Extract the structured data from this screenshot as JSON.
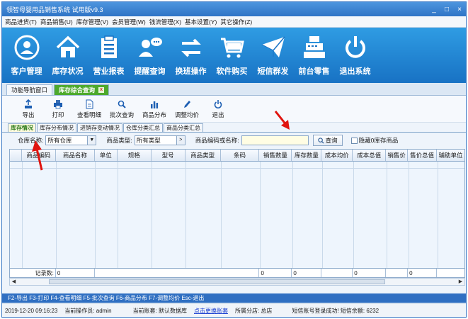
{
  "window": {
    "title": "领智母婴用品销售系统 试用版v9.3",
    "min": "_",
    "max": "□",
    "close": "×"
  },
  "menu": [
    "商品进货(T)",
    "商品销售(U)",
    "库存管理(V)",
    "会员管理(W)",
    "钱流管理(X)",
    "基本设置(Y)",
    "其它操作(Z)"
  ],
  "bigtoolbar": [
    {
      "label": "客户管理",
      "icon": "customer-icon"
    },
    {
      "label": "库存状况",
      "icon": "home-icon"
    },
    {
      "label": "营业报表",
      "icon": "report-icon"
    },
    {
      "label": "提醒查询",
      "icon": "reminder-chat-icon"
    },
    {
      "label": "换班操作",
      "icon": "shift-exchange-icon"
    },
    {
      "label": "软件购买",
      "icon": "shopping-cart-icon"
    },
    {
      "label": "短信群发",
      "icon": "sms-envelope-icon"
    },
    {
      "label": "前台零售",
      "icon": "cash-register-icon"
    },
    {
      "label": "退出系统",
      "icon": "power-icon"
    }
  ],
  "tabs": {
    "nav": "功能导航窗口",
    "current": "库存综合查询",
    "close_glyph": "x"
  },
  "smalltoolbar": [
    {
      "label": "导出",
      "icon": "export-icon"
    },
    {
      "label": "打印",
      "icon": "print-icon"
    },
    {
      "label": "查看明细",
      "icon": "detail-icon"
    },
    {
      "label": "批次查询",
      "icon": "batch-query-icon"
    },
    {
      "label": "商品分布",
      "icon": "bar-chart-icon"
    },
    {
      "label": "调整均价",
      "icon": "pencil-icon"
    },
    {
      "label": "退出",
      "icon": "power-icon"
    }
  ],
  "subtabs": [
    "库存情况",
    "库存分布情况",
    "进销存变动情况",
    "仓库分类汇总",
    "商品分类汇总"
  ],
  "filter": {
    "warehouse_label": "仓库名称:",
    "warehouse_value": "所有仓库",
    "type_label": "商品类型:",
    "type_value": "所有类型",
    "type_btn": ">",
    "code_label": "商品编码或名称:",
    "code_value": "",
    "query_label": "查询",
    "hide_zero_label": "隐藏0库存商品"
  },
  "grid": {
    "columns": [
      "商品编码",
      "商品名称",
      "单位",
      "规格",
      "型号",
      "商品类型",
      "条码",
      "销售数量",
      "库存数量",
      "成本均价",
      "成本总值",
      "销售价",
      "售价总值",
      "辅助单位"
    ],
    "footer": {
      "label": "记录数:",
      "count": "0",
      "sales_qty": "0",
      "stock_qty": "0",
      "cost_total": "0",
      "price_total": "0"
    }
  },
  "hotkeys": "F2-导出 F3-打印 F4-查看明细 F5-批次查询 F6-商品分布 F7-调整均价 Esc-退出",
  "status": {
    "datetime": "2019-12-20 09:16:23",
    "operator": "当前操作员: admin",
    "account": "当前账套: 默认数据库",
    "switch_link": "点击更换账套",
    "branch": "所属分店: 总店",
    "sms": "短信账号登录成功! 短信余额: 6232"
  },
  "colors": {
    "toolbar_blue": "#1f85d4",
    "active_tab_green": "#4da92c",
    "annotation_red": "#e0140f"
  }
}
